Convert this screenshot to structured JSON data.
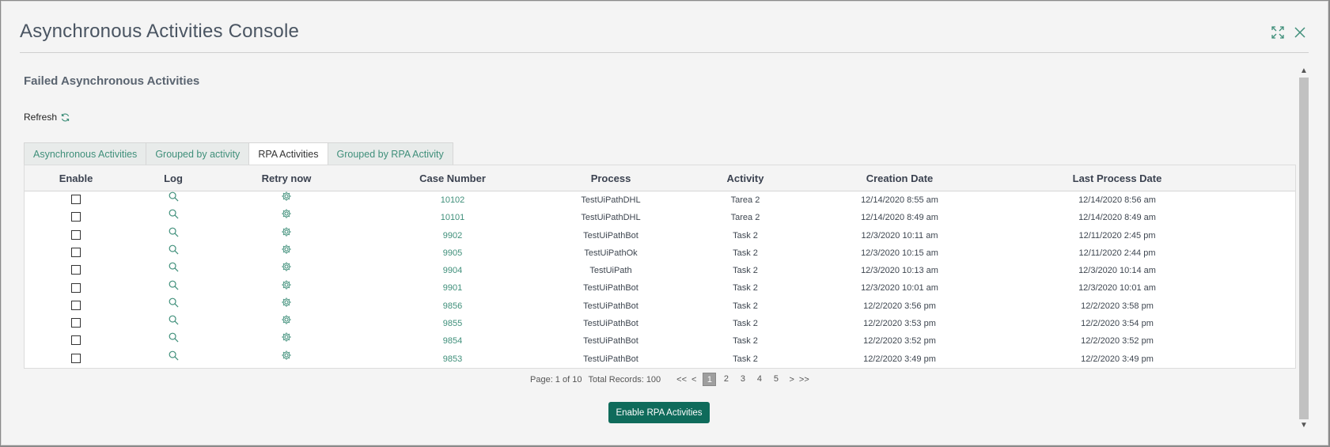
{
  "window": {
    "title": "Asynchronous Activities Console"
  },
  "section": {
    "title": "Failed Asynchronous Activities",
    "refresh_label": "Refresh"
  },
  "tabs": [
    {
      "label": "Asynchronous Activities",
      "active": false
    },
    {
      "label": "Grouped by activity",
      "active": false
    },
    {
      "label": "RPA Activities",
      "active": true
    },
    {
      "label": "Grouped by RPA Activity",
      "active": false
    }
  ],
  "table": {
    "headers": [
      "Enable",
      "Log",
      "Retry now",
      "Case Number",
      "Process",
      "Activity",
      "Creation Date",
      "Last Process Date"
    ],
    "rows": [
      {
        "case": "10102",
        "process": "TestUiPathDHL",
        "activity": "Tarea 2",
        "created": "12/14/2020 8:55 am",
        "last": "12/14/2020 8:56 am"
      },
      {
        "case": "10101",
        "process": "TestUiPathDHL",
        "activity": "Tarea 2",
        "created": "12/14/2020 8:49 am",
        "last": "12/14/2020 8:49 am"
      },
      {
        "case": "9902",
        "process": "TestUiPathBot",
        "activity": "Task 2",
        "created": "12/3/2020 10:11 am",
        "last": "12/11/2020 2:45 pm"
      },
      {
        "case": "9905",
        "process": "TestUiPathOk",
        "activity": "Task 2",
        "created": "12/3/2020 10:15 am",
        "last": "12/11/2020 2:44 pm"
      },
      {
        "case": "9904",
        "process": "TestUiPath",
        "activity": "Task 2",
        "created": "12/3/2020 10:13 am",
        "last": "12/3/2020 10:14 am"
      },
      {
        "case": "9901",
        "process": "TestUiPathBot",
        "activity": "Task 2",
        "created": "12/3/2020 10:01 am",
        "last": "12/3/2020 10:01 am"
      },
      {
        "case": "9856",
        "process": "TestUiPathBot",
        "activity": "Task 2",
        "created": "12/2/2020 3:56 pm",
        "last": "12/2/2020 3:58 pm"
      },
      {
        "case": "9855",
        "process": "TestUiPathBot",
        "activity": "Task 2",
        "created": "12/2/2020 3:53 pm",
        "last": "12/2/2020 3:54 pm"
      },
      {
        "case": "9854",
        "process": "TestUiPathBot",
        "activity": "Task 2",
        "created": "12/2/2020 3:52 pm",
        "last": "12/2/2020 3:52 pm"
      },
      {
        "case": "9853",
        "process": "TestUiPathBot",
        "activity": "Task 2",
        "created": "12/2/2020 3:49 pm",
        "last": "12/2/2020 3:49 pm"
      }
    ]
  },
  "pager": {
    "page_info": "Page: 1 of 10",
    "total_info": "Total Records: 100",
    "first": "<<",
    "prev": "<",
    "next": ">",
    "last": ">>",
    "pages": [
      "1",
      "2",
      "3",
      "4",
      "5"
    ],
    "current": "1"
  },
  "actions": {
    "enable_label": "Enable RPA Activities"
  },
  "colors": {
    "accent": "#3f8f7a",
    "button": "#0f6b5b"
  },
  "icons": {
    "maximize": "maximize-icon",
    "close": "close-icon",
    "refresh": "refresh-icon",
    "log": "magnifier-icon",
    "retry": "gear-icon"
  }
}
